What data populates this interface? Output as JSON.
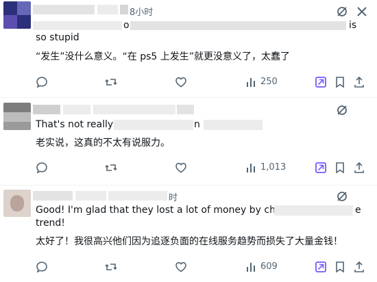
{
  "posts": [
    {
      "time": "8小时",
      "line1_fragment_a": "o",
      "line1_fragment_b": "is",
      "line2": "so stupid",
      "translation": "“发生”没什么意义。“在 ps5 上发生”就更没意义了，太蠢了",
      "views": "250"
    },
    {
      "line1_start": "That's not really v",
      "line1_mid": "n",
      "translation": "老实说，这真的不太有说服力。",
      "views": "1,013"
    },
    {
      "time": "时",
      "line1_start": "Good! I'm glad that they lost a lot of money by chasing",
      "line1_end": "e",
      "line2": "trend!",
      "translation": "太好了！我很高兴他们因为追逐负面的在线服务趋势而损失了大量金钱！",
      "views": "609"
    }
  ],
  "icons": {
    "reply": "reply-icon",
    "retweet": "retweet-icon",
    "like": "like-icon",
    "views": "views-icon",
    "grok": "grok-icon",
    "bookmark": "bookmark-icon",
    "share": "share-icon",
    "translate": "translate-icon"
  },
  "colors": {
    "text": "#0f1419",
    "muted": "#536471",
    "accent": "#7856ff"
  }
}
